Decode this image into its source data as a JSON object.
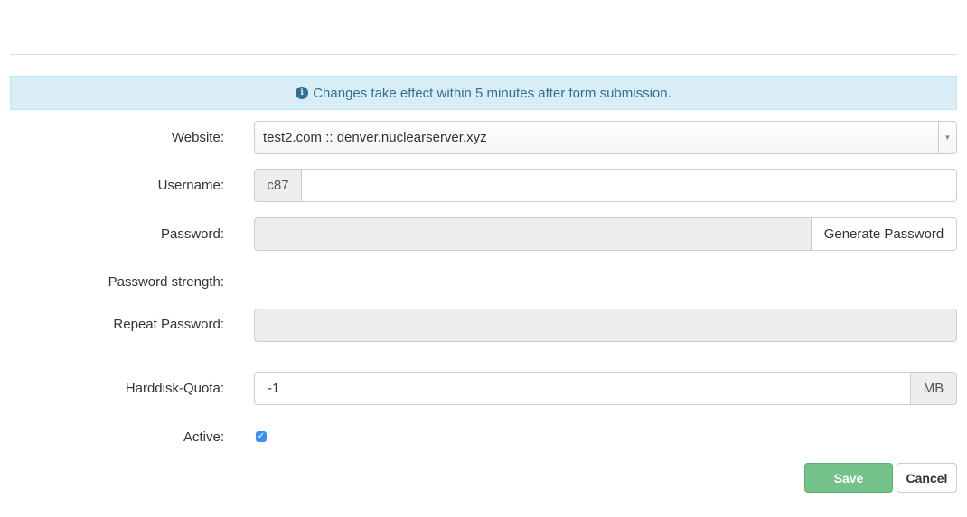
{
  "banner": {
    "icon": "info-icon",
    "text": "Changes take effect within 5 minutes after form submission."
  },
  "form": {
    "website": {
      "label": "Website:",
      "value": "test2.com :: denver.nuclearserver.xyz"
    },
    "username": {
      "label": "Username:",
      "prefix": "c87",
      "value": ""
    },
    "password": {
      "label": "Password:",
      "value": "",
      "generate_label": "Generate Password"
    },
    "password_strength": {
      "label": "Password strength:"
    },
    "repeat_password": {
      "label": "Repeat Password:",
      "value": ""
    },
    "quota": {
      "label": "Harddisk-Quota:",
      "value": "-1",
      "unit": "MB"
    },
    "active": {
      "label": "Active:",
      "checked": true
    }
  },
  "actions": {
    "save_label": "Save",
    "cancel_label": "Cancel"
  },
  "colors": {
    "banner_bg": "#d9edf7",
    "banner_text": "#31708f",
    "save_bg": "#74c28a",
    "checkbox": "#3b8ff5"
  }
}
